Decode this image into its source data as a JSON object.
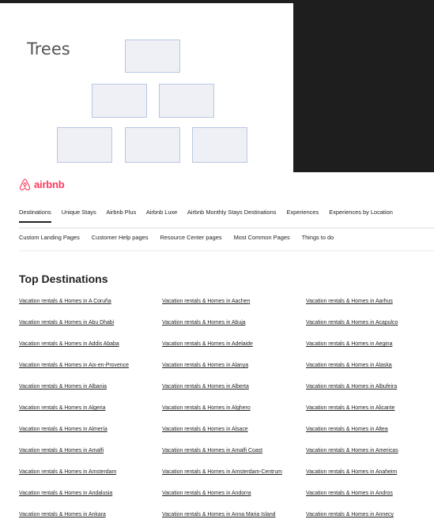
{
  "tree": {
    "title": "Trees"
  },
  "brand": {
    "name": "airbnb",
    "color": "#ff385c",
    "icon": "airbnb-logo-icon"
  },
  "nav": {
    "primary": [
      "Destinations",
      "Unique Stays",
      "Airbnb Plus",
      "Airbnb Luxe",
      "Airbnb Monthly Stays Destinations",
      "Experiences",
      "Experiences by Location"
    ],
    "secondary": [
      "Custom Landing Pages",
      "Customer Help pages",
      "Resource Center pages",
      "Most Common Pages",
      "Things to do"
    ]
  },
  "section": {
    "title": "Top Destinations"
  },
  "links": [
    "Vacation rentals & Homes in A Coruña",
    "Vacation rentals & Homes in Aachen",
    "Vacation rentals & Homes in Aarhus",
    "Vacation rentals & Homes in Abu Dhabi",
    "Vacation rentals & Homes in Abuja",
    "Vacation rentals & Homes in Acapulco",
    "Vacation rentals & Homes in Addis Ababa",
    "Vacation rentals & Homes in Adelaide",
    "Vacation rentals & Homes in Aegina",
    "Vacation rentals & Homes in Aix-en-Provence",
    "Vacation rentals & Homes in Alanya",
    "Vacation rentals & Homes in Alaska",
    "Vacation rentals & Homes in Albania",
    "Vacation rentals & Homes in Alberta",
    "Vacation rentals & Homes in Albufeira",
    "Vacation rentals & Homes in Algeria",
    "Vacation rentals & Homes in Alghero",
    "Vacation rentals & Homes in Alicante",
    "Vacation rentals & Homes in Almería",
    "Vacation rentals & Homes in Alsace",
    "Vacation rentals & Homes in Altea",
    "Vacation rentals & Homes in Amalfi",
    "Vacation rentals & Homes in Amalfi Coast",
    "Vacation rentals & Homes in Americas",
    "Vacation rentals & Homes in Amsterdam",
    "Vacation rentals & Homes in Amsterdam-Centrum",
    "Vacation rentals & Homes in Anaheim",
    "Vacation rentals & Homes in Andalusia",
    "Vacation rentals & Homes in Andorra",
    "Vacation rentals & Homes in Andros",
    "Vacation rentals & Homes in Ankara",
    "Vacation rentals & Homes in Anna Maria Island",
    "Vacation rentals & Homes in Annecy"
  ]
}
